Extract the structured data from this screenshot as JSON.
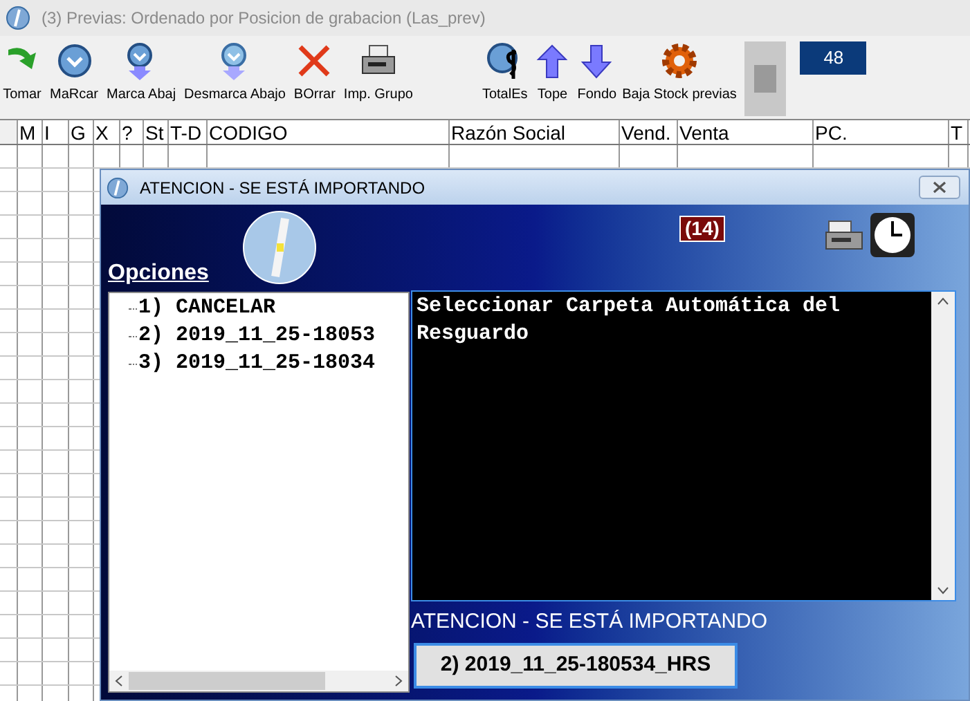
{
  "window": {
    "title": "(3) Previas: Ordenado por Posicion de grabacion (Las_prev)"
  },
  "toolbar_left": [
    {
      "label": "Tomar",
      "kind": "take"
    },
    {
      "label": "MaRcar",
      "kind": "mark"
    },
    {
      "label": "Marca Abaj",
      "kind": "mark-down"
    },
    {
      "label": "Desmarca Abajo",
      "kind": "unmark-down"
    },
    {
      "label": "BOrrar",
      "kind": "delete"
    },
    {
      "label": "Imp. Grupo",
      "kind": "print"
    }
  ],
  "toolbar_right": [
    {
      "label": "TotalEs",
      "kind": "totals"
    },
    {
      "label": "Tope",
      "kind": "top"
    },
    {
      "label": "Fondo",
      "kind": "bottom"
    },
    {
      "label": "Baja Stock previas",
      "kind": "gear"
    }
  ],
  "counter": "48",
  "table": {
    "columns": [
      "M",
      "I",
      "G",
      "X",
      "?",
      "St",
      "T-D",
      "CODIGO",
      "Razón Social",
      "Vend.",
      "Venta",
      "PC.",
      "T"
    ]
  },
  "dialog": {
    "title": "ATENCION - SE ESTÁ IMPORTANDO",
    "options_label": "Opciones",
    "badge": "(14)",
    "options": [
      {
        "label": "1) CANCELAR"
      },
      {
        "label": "2) 2019_11_25-18053"
      },
      {
        "label": "3) 2019_11_25-18034"
      }
    ],
    "message": "Seleccionar Carpeta Automática del Resguardo",
    "status": "ATENCION - SE ESTÁ IMPORTANDO",
    "selection_button": "2) 2019_11_25-180534_HRS"
  }
}
